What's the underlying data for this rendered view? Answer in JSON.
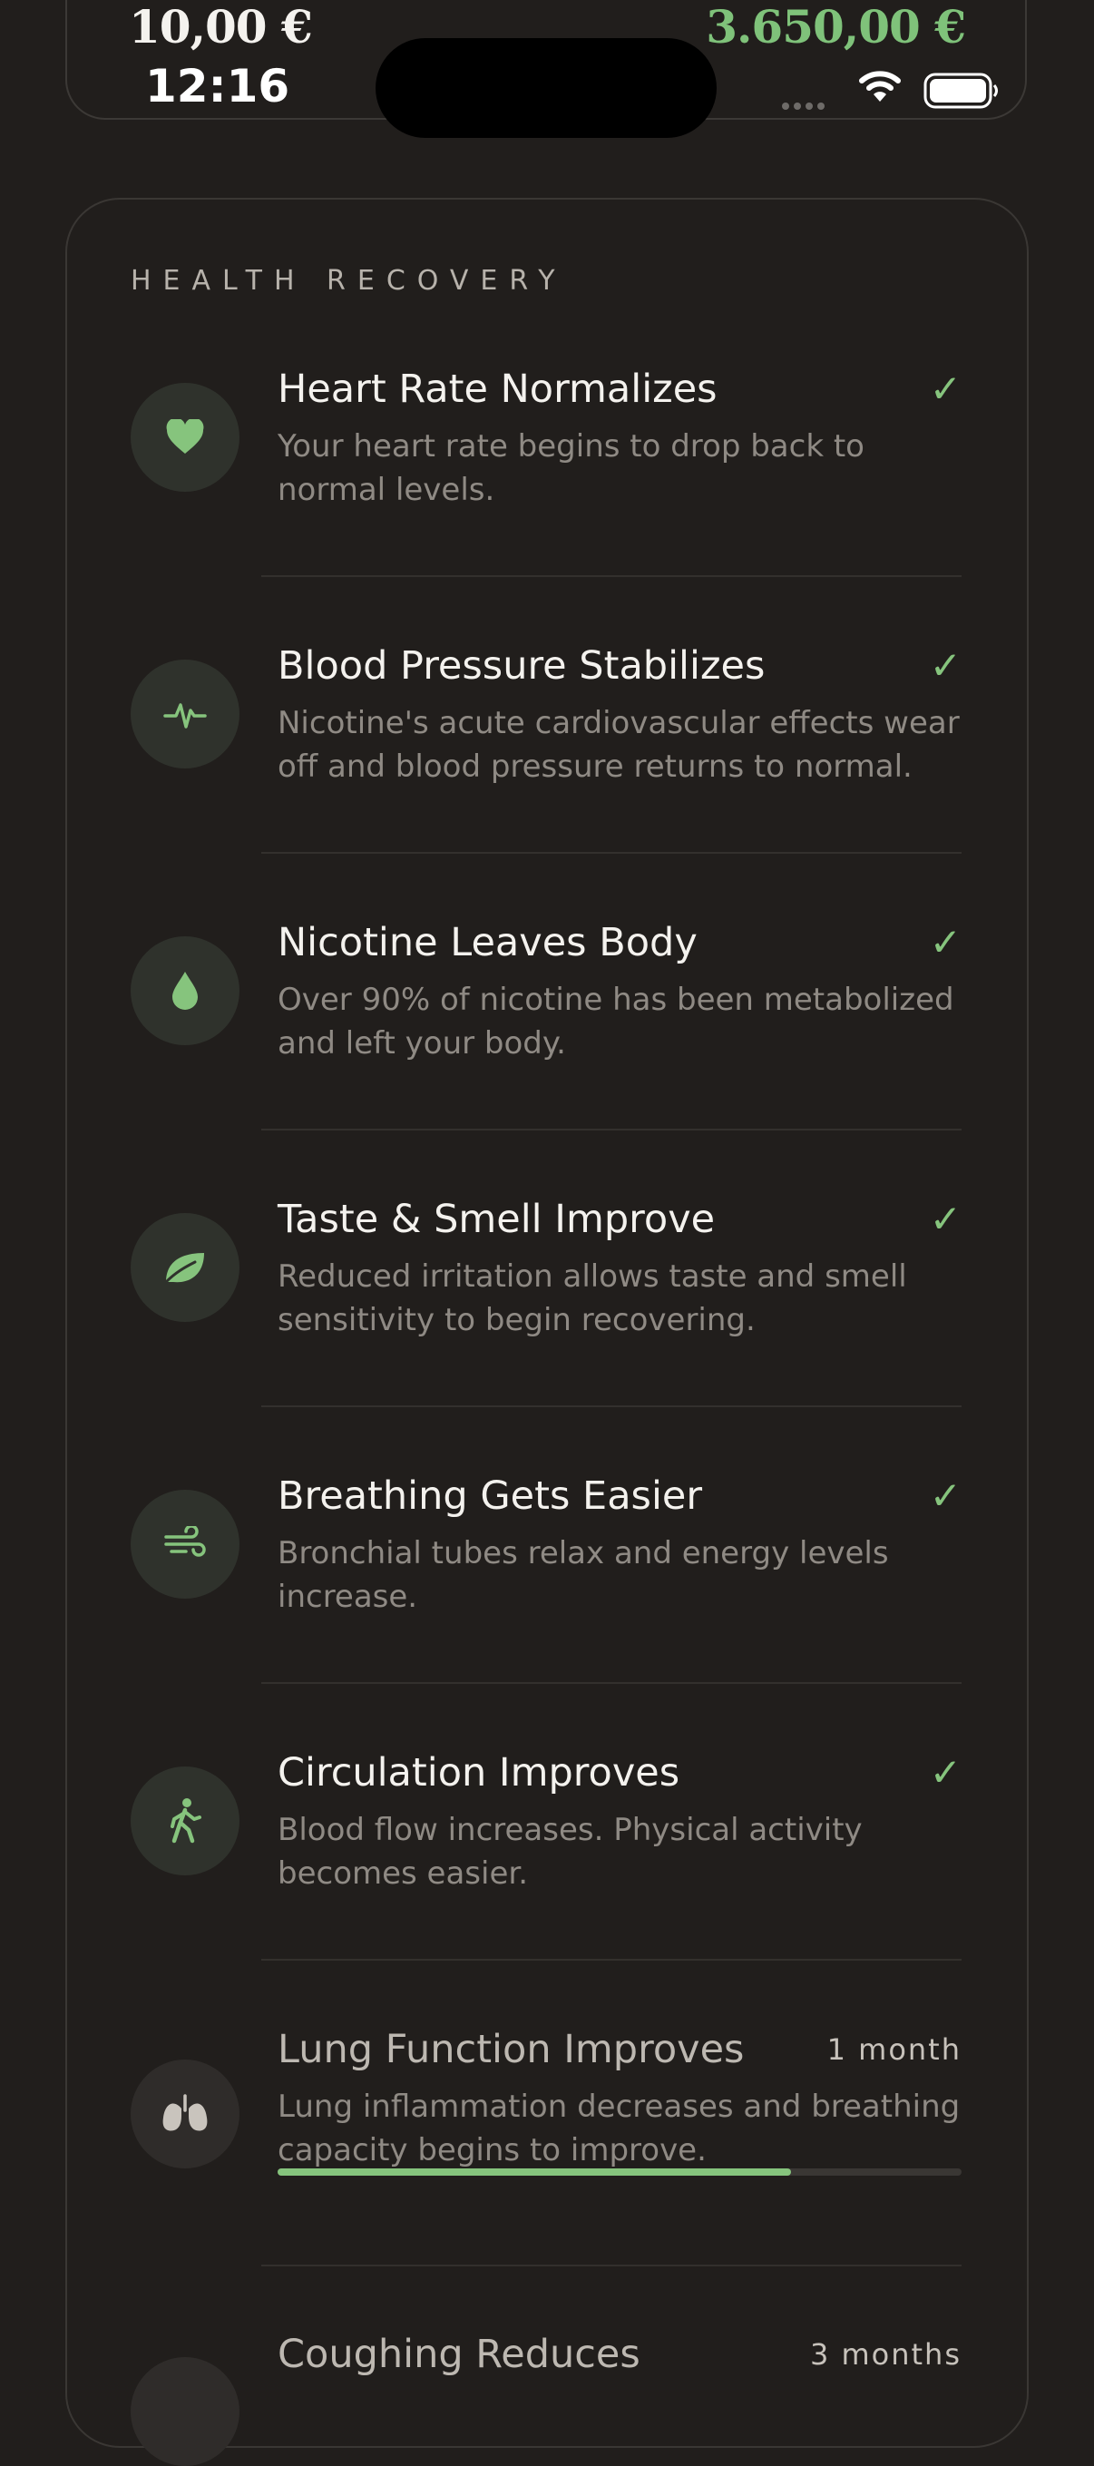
{
  "top_stats": {
    "left_value": "10,00 €",
    "right_value": "3.650,00 €"
  },
  "status_bar": {
    "time": "12:16"
  },
  "section": {
    "title": "HEALTH RECOVERY"
  },
  "items": [
    {
      "title": "Heart Rate Normalizes",
      "desc": "Your heart rate begins to drop back to normal levels.",
      "status": "complete",
      "check": "✓",
      "icon": "heart-icon"
    },
    {
      "title": "Blood Pressure Stabilizes",
      "desc": "Nicotine's acute cardiovascular effects wear off and blood pressure returns to normal.",
      "status": "complete",
      "check": "✓",
      "icon": "pulse-icon"
    },
    {
      "title": "Nicotine Leaves Body",
      "desc": "Over 90% of nicotine has been metabolized and left your body.",
      "status": "complete",
      "check": "✓",
      "icon": "drop-icon"
    },
    {
      "title": "Taste & Smell Improve",
      "desc": "Reduced irritation allows taste and smell sensitivity to begin recovering.",
      "status": "complete",
      "check": "✓",
      "icon": "leaf-icon"
    },
    {
      "title": "Breathing Gets Easier",
      "desc": "Bronchial tubes relax and energy levels increase.",
      "status": "complete",
      "check": "✓",
      "icon": "wind-icon"
    },
    {
      "title": "Circulation Improves",
      "desc": "Blood flow increases. Physical activity becomes easier.",
      "status": "complete",
      "check": "✓",
      "icon": "walking-icon"
    },
    {
      "title": "Lung Function Improves",
      "desc": "Lung inflammation decreases and breathing capacity begins to improve.",
      "status": "in-progress",
      "duration": "1 month",
      "progress": 0.75,
      "icon": "lungs-icon"
    },
    {
      "title": "Coughing Reduces",
      "desc": "",
      "status": "pending",
      "duration": "3 months",
      "icon": "cough-icon"
    }
  ],
  "colors": {
    "accent": "#86c47d",
    "background": "#211e1c",
    "money": "#7fc27a"
  }
}
